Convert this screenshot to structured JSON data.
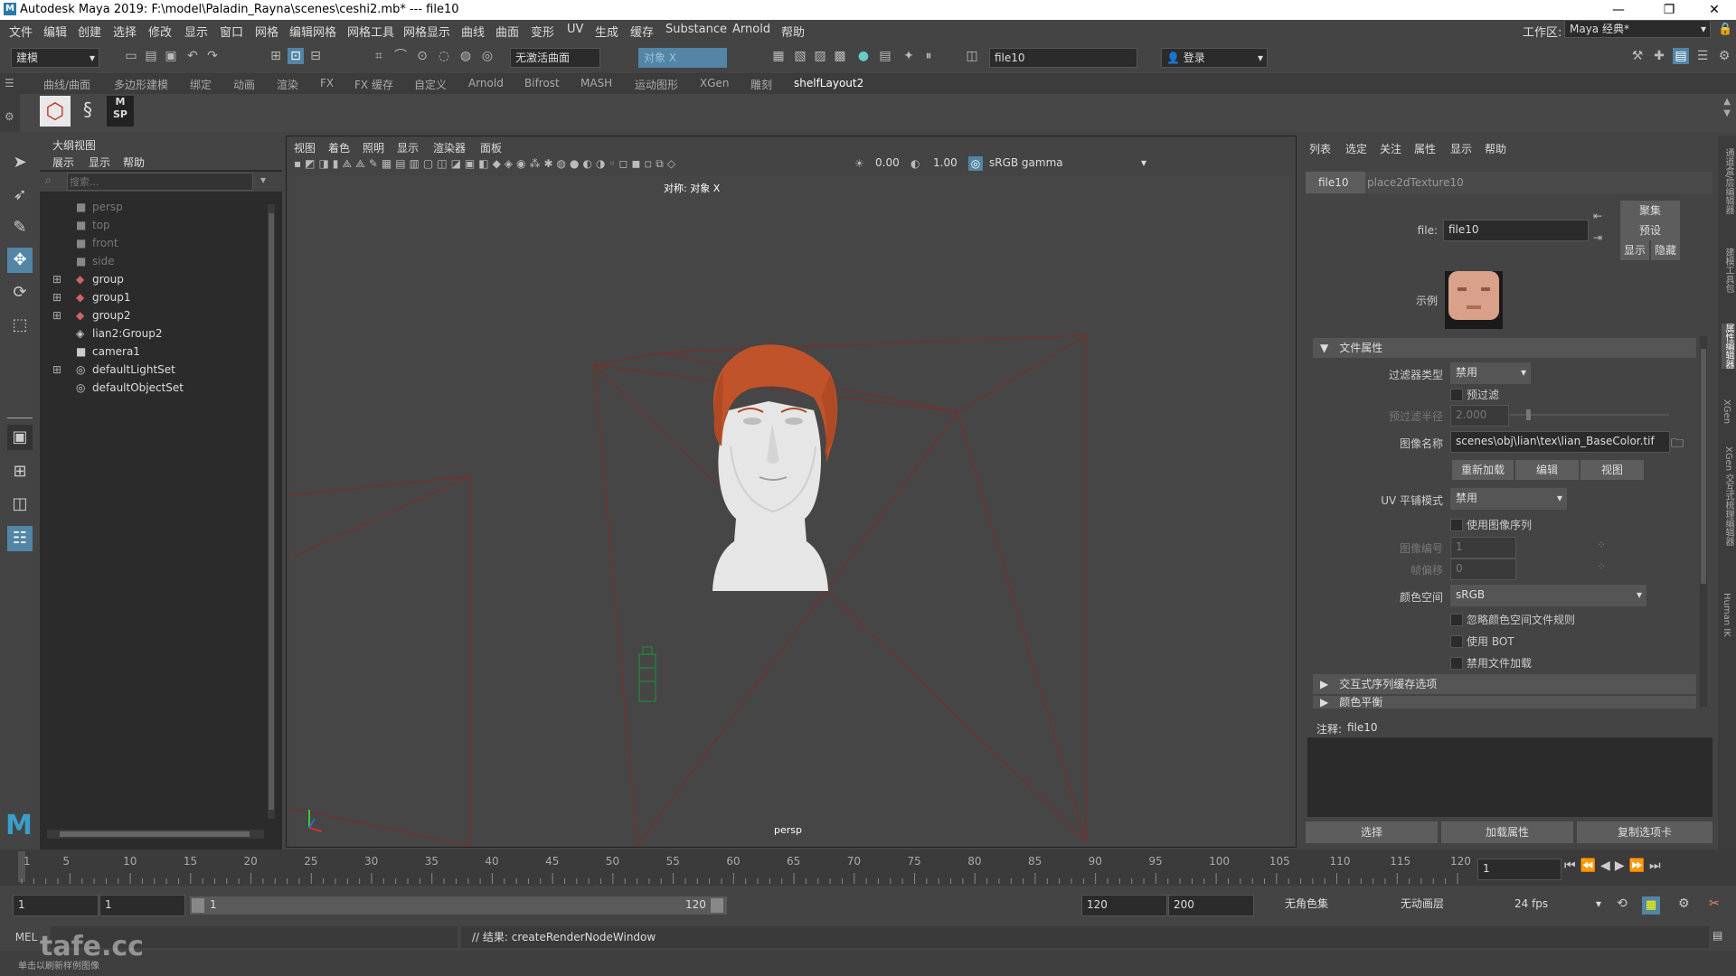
{
  "title_bar": {
    "title": "Autodesk Maya 2019: F:\\model\\Paladin_Rayna\\scenes\\ceshi2.mb*   ---   file10",
    "minimize": "—",
    "maximize": "❐",
    "close": "✕"
  },
  "menu": [
    "文件",
    "编辑",
    "创建",
    "选择",
    "修改",
    "显示",
    "窗口",
    "网格",
    "编辑网格",
    "网格工具",
    "网格显示",
    "曲线",
    "曲面",
    "变形",
    "UV",
    "生成",
    "缓存",
    "Substance",
    "Arnold",
    "帮助"
  ],
  "workspace": {
    "label": "工作区:",
    "value": "Maya 经典*"
  },
  "toolbar": {
    "mode": "建模",
    "live_surface": "无激活曲面",
    "symmetry": "对象 X",
    "render_field": "file10",
    "login": "登录"
  },
  "shelf_tabs": [
    "曲线/曲面",
    "多边形建模",
    "绑定",
    "动画",
    "渲染",
    "FX",
    "FX 缓存",
    "自定义",
    "Arnold",
    "Bifrost",
    "MASH",
    "运动图形",
    "XGen",
    "雕刻",
    "shelfLayout2"
  ],
  "shelf_active": "shelfLayout2",
  "shelf_icon_sp": "SP",
  "outliner": {
    "title": "大纲视图",
    "menu": [
      "展示",
      "显示",
      "帮助"
    ],
    "search_placeholder": "搜索...",
    "items": [
      {
        "label": "persp",
        "dim": true,
        "expandable": false
      },
      {
        "label": "top",
        "dim": true,
        "expandable": false
      },
      {
        "label": "front",
        "dim": true,
        "expandable": false
      },
      {
        "label": "side",
        "dim": true,
        "expandable": false
      },
      {
        "label": "group",
        "dim": false,
        "expandable": true
      },
      {
        "label": "group1",
        "dim": false,
        "expandable": true
      },
      {
        "label": "group2",
        "dim": false,
        "expandable": true
      },
      {
        "label": "lian2:Group2",
        "dim": false,
        "expandable": false
      },
      {
        "label": "camera1",
        "dim": false,
        "expandable": false
      },
      {
        "label": "defaultLightSet",
        "dim": false,
        "expandable": true
      },
      {
        "label": "defaultObjectSet",
        "dim": false,
        "expandable": false
      }
    ]
  },
  "viewport": {
    "menu": [
      "视图",
      "着色",
      "照明",
      "显示",
      "渲染器",
      "面板"
    ],
    "exposure": "0.00",
    "gamma": "1.00",
    "color_space": "sRGB gamma",
    "hud_symmetry": "对称: 对象 X",
    "camera_label": "persp"
  },
  "attribute_editor": {
    "menu": [
      "列表",
      "选定",
      "关注",
      "属性",
      "显示",
      "帮助"
    ],
    "tabs": [
      "file10",
      "place2dTexture10"
    ],
    "file_label": "file:",
    "file_value": "file10",
    "focus_btn": "聚集",
    "preset_btn": "预设",
    "show_btn": "显示",
    "hide_btn": "隐藏",
    "sample_label": "示例",
    "section_file_attrs": "文件属性",
    "filter_type_label": "过滤器类型",
    "filter_type_value": "禁用",
    "prefilter_label": "预过滤",
    "prefilter_radius_label": "预过滤半径",
    "prefilter_radius_value": "2.000",
    "image_name_label": "图像名称",
    "image_name_value": "scenes\\obj\\lian\\tex\\lian_BaseColor.tif",
    "reload_btn": "重新加载",
    "edit_btn": "编辑",
    "view_btn": "视图",
    "uv_tiling_label": "UV 平铺模式",
    "uv_tiling_value": "禁用",
    "use_seq_label": "使用图像序列",
    "frame_label": "图像编号",
    "frame_value": "1",
    "frame_offset_label": "帧偏移",
    "frame_offset_value": "0",
    "color_space_label": "颜色空间",
    "color_space_value": "sRGB",
    "ignore_rules_label": "忽略颜色空间文件规则",
    "use_bot_label": "使用 BOT",
    "disable_load_label": "禁用文件加载",
    "section_interactive": "交互式序列缓存选项",
    "section_color_balance": "颜色平衡",
    "notes_label": "注释:",
    "notes_value": "file10",
    "select_btn": "选择",
    "load_attr_btn": "加载属性",
    "copy_tab_btn": "复制选项卡"
  },
  "side_tabs": [
    "通道盒/层编辑器",
    "建模工具包",
    "属性编辑器",
    "XGen",
    "XGen 交互式梳理编辑器",
    "Human IK"
  ],
  "timeline": {
    "ticks": [
      "1",
      "5",
      "10",
      "15",
      "20",
      "25",
      "30",
      "35",
      "40",
      "45",
      "50",
      "55",
      "60",
      "65",
      "70",
      "75",
      "80",
      "85",
      "90",
      "95",
      "100",
      "105",
      "110",
      "115",
      "120"
    ],
    "current_frame": "1"
  },
  "range": {
    "start": "1",
    "playback_start": "1",
    "slider_start": "1",
    "slider_end": "120",
    "playback_end": "120",
    "end": "200",
    "char_set": "无角色集",
    "anim_layer": "无动画层",
    "fps": "24 fps"
  },
  "command": {
    "lang": "MEL",
    "result": "// 结果: createRenderNodeWindow"
  },
  "help_line": "单击以刷新样例图像",
  "watermark": "tafe.cc",
  "colors": {
    "accent": "#5285a6",
    "hair": "#c0532a",
    "wire": "#7a2e2a"
  }
}
